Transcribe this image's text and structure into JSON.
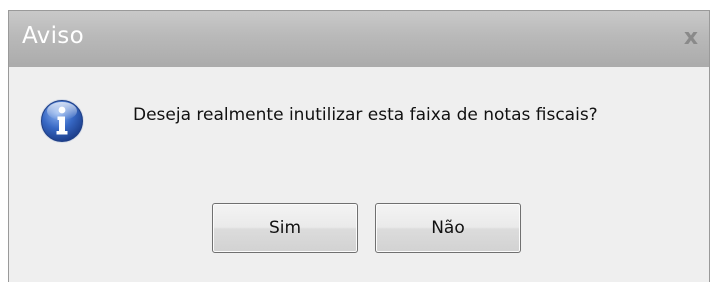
{
  "window": {
    "title": "Aviso",
    "close_glyph": "x"
  },
  "dialog": {
    "icon": "info-icon",
    "message": "Deseja realmente inutilizar esta faixa de notas fiscais?"
  },
  "buttons": {
    "yes_label": "Sim",
    "no_label": "Não"
  },
  "colors": {
    "icon_blue": "#2f5fb8",
    "titlebar": "#b9b9b9",
    "background": "#efefef"
  }
}
